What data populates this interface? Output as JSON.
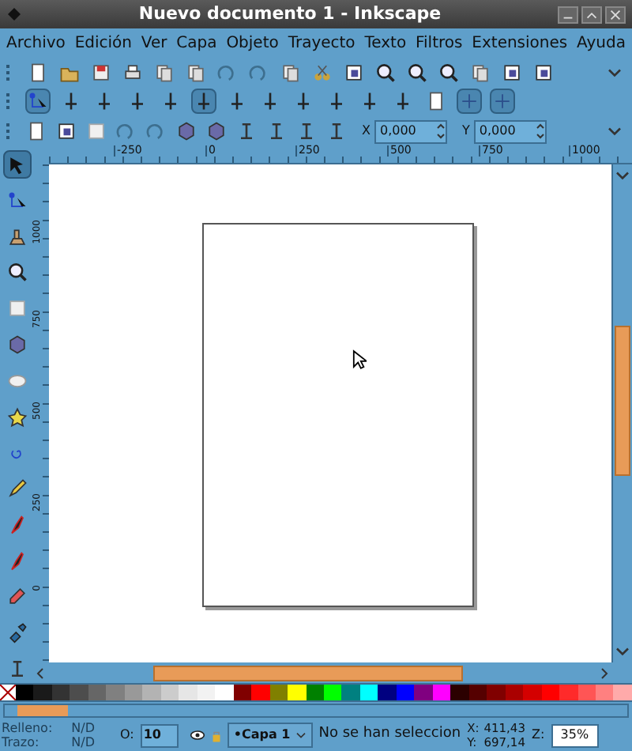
{
  "window": {
    "title": "Nuevo documento 1 - Inkscape"
  },
  "menu": [
    "Archivo",
    "Edición",
    "Ver",
    "Capa",
    "Objeto",
    "Trayecto",
    "Texto",
    "Filtros",
    "Extensiones",
    "Ayuda"
  ],
  "snap_buttons": [
    {
      "on": true
    },
    {
      "on": false
    },
    {
      "on": false
    },
    {
      "on": false
    },
    {
      "on": false
    },
    {
      "on": true
    },
    {
      "on": false
    },
    {
      "on": false
    },
    {
      "on": false
    },
    {
      "on": false
    },
    {
      "on": false
    },
    {
      "on": false
    },
    {
      "on": false
    },
    {
      "on": true
    },
    {
      "on": true
    }
  ],
  "coords": [
    {
      "label": "X",
      "value": "0,000"
    },
    {
      "label": "Y",
      "value": "0,000"
    }
  ],
  "ruler_h": [
    "-250",
    "0",
    "250",
    "500",
    "750",
    "1000"
  ],
  "ruler_v": [
    "1000",
    "750",
    "500",
    "250",
    "0"
  ],
  "tools": [
    {
      "selected": true
    },
    {
      "selected": false
    },
    {
      "selected": false
    },
    {
      "selected": false
    },
    {
      "selected": false
    },
    {
      "selected": false
    },
    {
      "selected": false
    },
    {
      "selected": false
    },
    {
      "selected": false
    },
    {
      "selected": false
    },
    {
      "selected": false
    },
    {
      "selected": false
    },
    {
      "selected": false
    },
    {
      "selected": false
    },
    {
      "selected": false
    }
  ],
  "palette": [
    {
      "color": "#000000"
    },
    {
      "color": "#1a1a1a"
    },
    {
      "color": "#333333"
    },
    {
      "color": "#4d4d4d"
    },
    {
      "color": "#666666"
    },
    {
      "color": "#808080"
    },
    {
      "color": "#999999"
    },
    {
      "color": "#b3b3b3"
    },
    {
      "color": "#cccccc"
    },
    {
      "color": "#e6e6e6"
    },
    {
      "color": "#f2f2f2"
    },
    {
      "color": "#ffffff"
    },
    {
      "color": "#800000"
    },
    {
      "color": "#ff0000"
    },
    {
      "color": "#808000"
    },
    {
      "color": "#ffff00"
    },
    {
      "color": "#008000"
    },
    {
      "color": "#00ff00"
    },
    {
      "color": "#008080"
    },
    {
      "color": "#00ffff"
    },
    {
      "color": "#000080"
    },
    {
      "color": "#0000ff"
    },
    {
      "color": "#800080"
    },
    {
      "color": "#ff00ff"
    },
    {
      "color": "#2b0000"
    },
    {
      "color": "#550000"
    },
    {
      "color": "#800000"
    },
    {
      "color": "#aa0000"
    },
    {
      "color": "#d40000"
    },
    {
      "color": "#ff0000"
    },
    {
      "color": "#ff2a2a"
    },
    {
      "color": "#ff5555"
    },
    {
      "color": "#ff8080"
    },
    {
      "color": "#ffaaaa"
    }
  ],
  "status": {
    "fill_label": "Relleno:",
    "fill_value": "N/D",
    "stroke_label": "Trazo:",
    "stroke_value": "N/D",
    "opacity_label": "O:",
    "opacity_value": "10",
    "layer": "•Capa 1",
    "message": "No se han seleccion",
    "x_label": "X:",
    "x_value": "411,43",
    "y_label": "Y:",
    "y_value": "697,14",
    "zoom_label": "Z:",
    "zoom_value": "35%"
  }
}
